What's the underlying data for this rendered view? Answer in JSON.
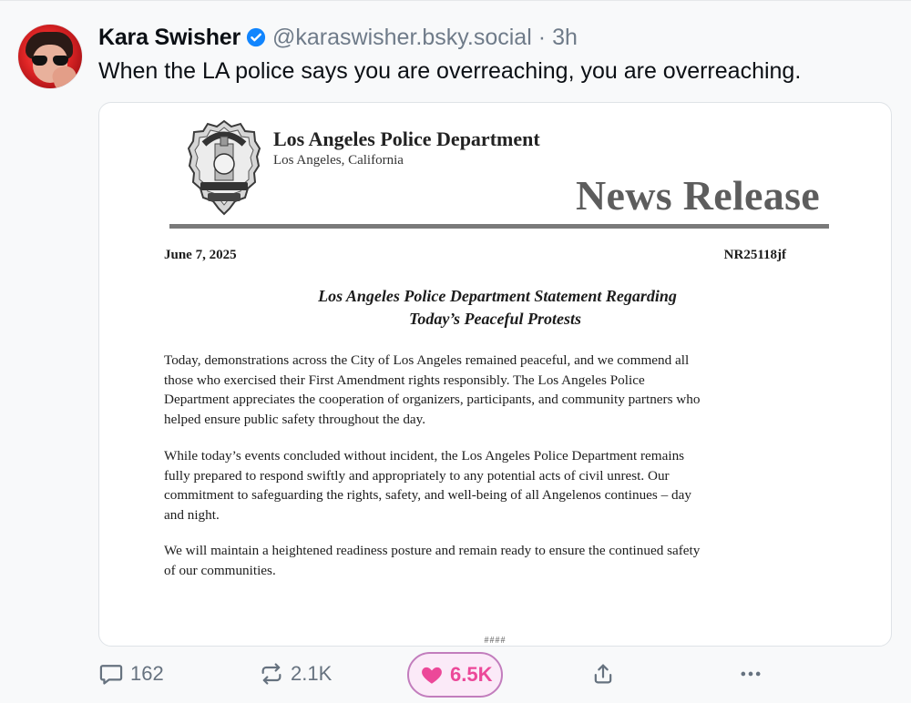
{
  "post": {
    "author": {
      "display_name": "Kara Swisher",
      "handle": "@karaswisher.bsky.social",
      "verified": true
    },
    "separator": "·",
    "timestamp": "3h",
    "text": "When the LA police says you are overreaching, you are overreaching.",
    "media": {
      "dept_name": "Los Angeles Police Department",
      "dept_location": "Los Angeles, California",
      "doc_type": "News Release",
      "date": "June 7, 2025",
      "number": "NR25118jf",
      "headline": [
        "Los Angeles Police Department Statement Regarding",
        "Today’s Peaceful Protests"
      ],
      "paragraphs": [
        [
          "Today, demonstrations across the City of Los Angeles remained peaceful, and we commend all",
          "those who exercised their First Amendment rights responsibly. The Los Angeles Police",
          "Department appreciates the cooperation of organizers, participants, and community partners who",
          "helped ensure public safety throughout the day."
        ],
        [
          "While today’s events concluded without incident, the Los Angeles Police Department remains",
          "fully prepared to respond swiftly and appropriately to any potential acts of civil unrest. Our",
          "commitment to safeguarding the rights, safety, and well-being of all Angelenos continues – day",
          "and night."
        ],
        [
          "We will maintain a heightened readiness posture and remain ready to ensure the continued safety",
          "of our communities."
        ]
      ],
      "footer_mark": "####"
    },
    "actions": {
      "reply_count": "162",
      "repost_count": "2.1K",
      "like_count": "6.5K",
      "liked": true
    }
  },
  "colors": {
    "background": "#f8f9fa",
    "text": "#0b0f14",
    "muted": "#6f7b89",
    "verified": "#1185fe",
    "like": "#ec4899",
    "like_border": "#c27dbd",
    "like_bg": "#fbeaf8"
  },
  "icons": {
    "verified": "verified-badge-icon",
    "reply": "speech-bubble-icon",
    "repost": "repost-arrows-icon",
    "like": "heart-icon",
    "share": "share-upload-icon",
    "more": "ellipsis-icon"
  }
}
